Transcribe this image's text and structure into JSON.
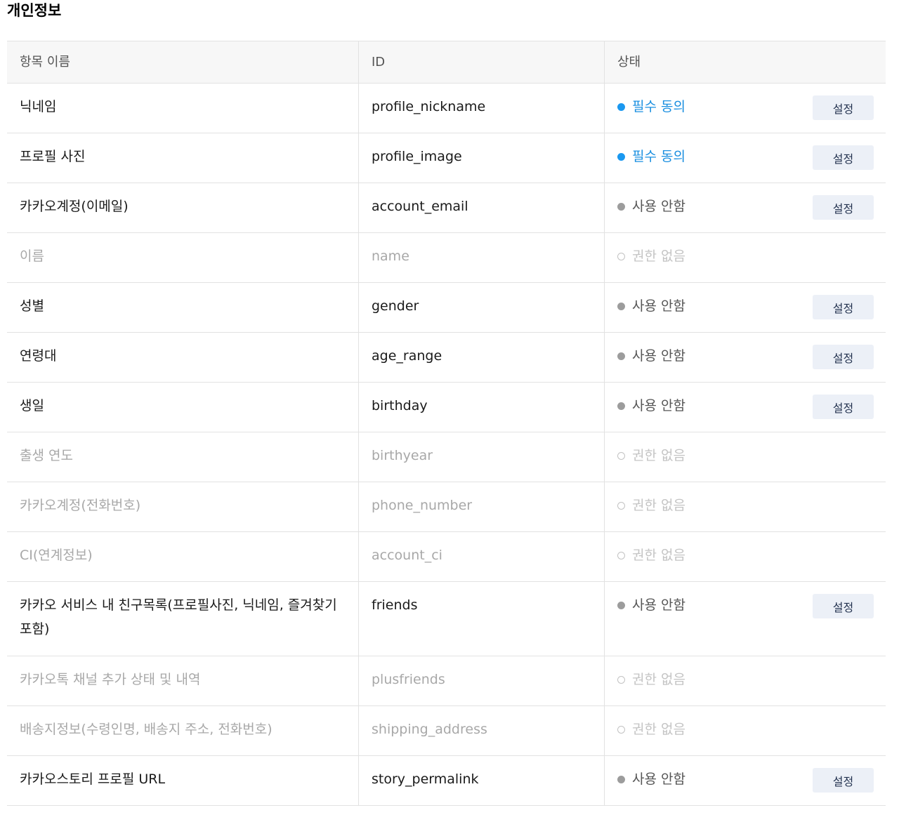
{
  "page_title": "개인정보",
  "table": {
    "headers": {
      "name": "항목 이름",
      "id": "ID",
      "status": "상태"
    },
    "button_label": "설정",
    "status_colors": {
      "required": "#1a98f0",
      "unused": "#9c9c9c",
      "none": "#c2c2c2"
    },
    "rows": [
      {
        "name": "닉네임",
        "id": "profile_nickname",
        "status": "필수 동의",
        "status_type": "required",
        "has_button": true
      },
      {
        "name": "프로필 사진",
        "id": "profile_image",
        "status": "필수 동의",
        "status_type": "required",
        "has_button": true
      },
      {
        "name": "카카오계정(이메일)",
        "id": "account_email",
        "status": "사용 안함",
        "status_type": "unused",
        "has_button": true
      },
      {
        "name": "이름",
        "id": "name",
        "status": "권한 없음",
        "status_type": "none",
        "has_button": false
      },
      {
        "name": "성별",
        "id": "gender",
        "status": "사용 안함",
        "status_type": "unused",
        "has_button": true
      },
      {
        "name": "연령대",
        "id": "age_range",
        "status": "사용 안함",
        "status_type": "unused",
        "has_button": true
      },
      {
        "name": "생일",
        "id": "birthday",
        "status": "사용 안함",
        "status_type": "unused",
        "has_button": true
      },
      {
        "name": "출생 연도",
        "id": "birthyear",
        "status": "권한 없음",
        "status_type": "none",
        "has_button": false
      },
      {
        "name": "카카오계정(전화번호)",
        "id": "phone_number",
        "status": "권한 없음",
        "status_type": "none",
        "has_button": false
      },
      {
        "name": "CI(연계정보)",
        "id": "account_ci",
        "status": "권한 없음",
        "status_type": "none",
        "has_button": false
      },
      {
        "name": "카카오 서비스 내 친구목록(프로필사진, 닉네임, 즐겨찾기 포함)",
        "id": "friends",
        "status": "사용 안함",
        "status_type": "unused",
        "has_button": true,
        "tall": true
      },
      {
        "name": "카카오톡 채널 추가 상태 및 내역",
        "id": "plusfriends",
        "status": "권한 없음",
        "status_type": "none",
        "has_button": false
      },
      {
        "name": "배송지정보(수령인명, 배송지 주소, 전화번호)",
        "id": "shipping_address",
        "status": "권한 없음",
        "status_type": "none",
        "has_button": false
      },
      {
        "name": "카카오스토리 프로필 URL",
        "id": "story_permalink",
        "status": "사용 안함",
        "status_type": "unused",
        "has_button": true
      }
    ]
  }
}
